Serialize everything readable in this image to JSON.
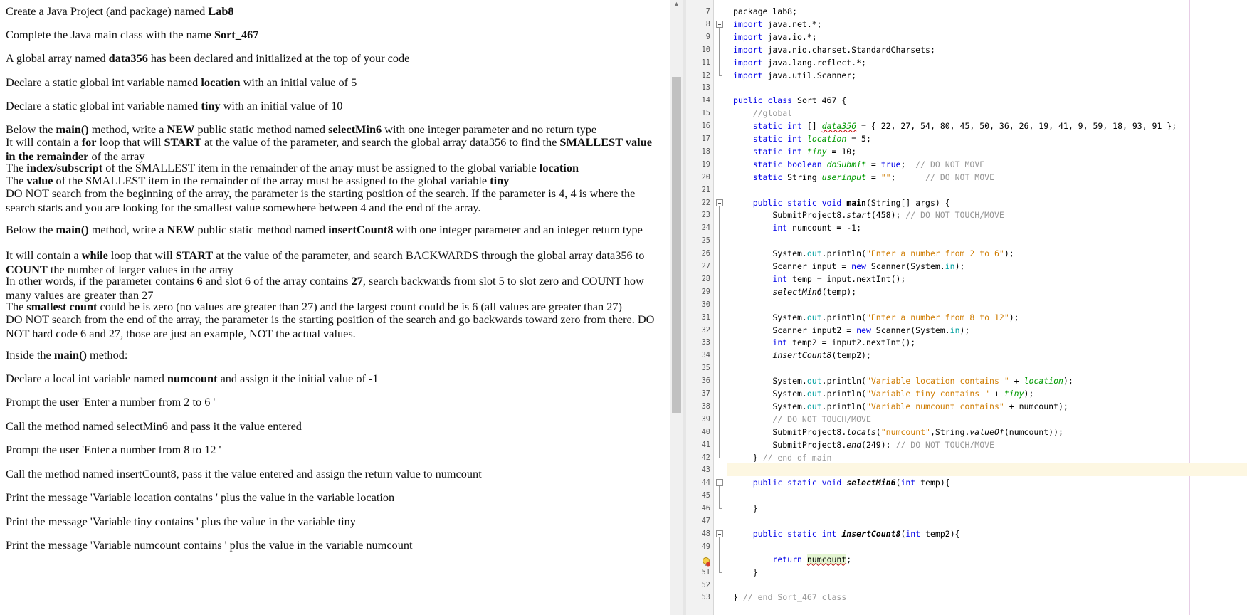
{
  "instructions": [
    [
      [
        "Create a Java Project (and package) named ",
        false
      ],
      [
        "Lab8",
        true
      ]
    ],
    [
      [
        "Complete the Java main class with the name ",
        false
      ],
      [
        "Sort_467",
        true
      ]
    ],
    [
      [
        "A global array named ",
        false
      ],
      [
        "data356",
        true
      ],
      [
        " has been declared and initialized at the top of your code",
        false
      ]
    ],
    [
      [
        "Declare a static global int variable named ",
        false
      ],
      [
        "location",
        true
      ],
      [
        " with an initial value of 5",
        false
      ]
    ],
    [
      [
        "Declare a static global int variable named ",
        false
      ],
      [
        "tiny",
        true
      ],
      [
        " with an initial value of 10",
        false
      ]
    ],
    [
      [
        "Below the ",
        false
      ],
      [
        "main()",
        true
      ],
      [
        " method, write a ",
        false
      ],
      [
        "NEW",
        true
      ],
      [
        " public static method named ",
        false
      ],
      [
        "selectMin6",
        true
      ],
      [
        " with one integer parameter and no return type",
        false
      ]
    ],
    [
      [
        "It will contain a ",
        false
      ],
      [
        "for",
        true
      ],
      [
        " loop that will ",
        false
      ],
      [
        "START",
        true
      ],
      [
        " at the value of the parameter, and search the global array data356 to find the ",
        false
      ],
      [
        "SMALLEST value in the remainder",
        true
      ],
      [
        " of the array",
        false
      ]
    ],
    [
      [
        "The ",
        false
      ],
      [
        "index/subscript",
        true
      ],
      [
        " of the SMALLEST item in the remainder of the array must be assigned to the global variable ",
        false
      ],
      [
        "location",
        true
      ]
    ],
    [
      [
        "The ",
        false
      ],
      [
        "value",
        true
      ],
      [
        " of the SMALLEST item in the remainder of the array must be assigned to the global variable ",
        false
      ],
      [
        "tiny",
        true
      ]
    ],
    [
      [
        "DO NOT search from the beginning of the array, the parameter is the starting position of the search. If the parameter is 4, 4 is where the search starts and you are looking for the smallest value somewhere between 4 and the end of the array.",
        false
      ]
    ],
    [
      [
        "Below the ",
        false
      ],
      [
        "main()",
        true
      ],
      [
        " method, write a ",
        false
      ],
      [
        "NEW",
        true
      ],
      [
        " public static method named ",
        false
      ],
      [
        "insertCount8",
        true
      ],
      [
        " with one integer parameter and an integer return type",
        false
      ]
    ],
    [
      [
        "It will contain a ",
        false
      ],
      [
        "while",
        true
      ],
      [
        " loop that will ",
        false
      ],
      [
        "START",
        true
      ],
      [
        " at the value of the parameter, and search BACKWARDS through the global array data356 to ",
        false
      ],
      [
        "COUNT",
        true
      ],
      [
        " the number of larger values in the array",
        false
      ]
    ],
    [
      [
        "In other words, if the parameter contains ",
        false
      ],
      [
        "6",
        true
      ],
      [
        " and slot 6 of the array contains ",
        false
      ],
      [
        "27",
        true
      ],
      [
        ", search backwards from slot 5 to slot zero and COUNT how many values are greater than 27",
        false
      ]
    ],
    [
      [
        "The ",
        false
      ],
      [
        "smallest count",
        true
      ],
      [
        " could be is zero (no values are greater than 27) and the largest count could be is 6 (all values are greater than 27)",
        false
      ]
    ],
    [
      [
        "DO NOT search from the end of the array, the parameter is the starting position of the search and go backwards toward zero from there. DO NOT hard code 6 and 27, those are just an example, NOT the actual values.",
        false
      ]
    ],
    [
      [
        "Inside the ",
        false
      ],
      [
        "main()",
        true
      ],
      [
        " method:",
        false
      ]
    ],
    [
      [
        "Declare a local int variable named ",
        false
      ],
      [
        "numcount",
        true
      ],
      [
        " and assign it the initial value of -1",
        false
      ]
    ],
    [
      [
        "Prompt the user 'Enter a number from 2 to 6 '",
        false
      ]
    ],
    [
      [
        "Call the method named selectMin6 and pass it the value entered",
        false
      ]
    ],
    [
      [
        "Prompt the user 'Enter a number from 8 to 12 '",
        false
      ]
    ],
    [
      [
        "Call the method named insertCount8, pass it the value entered and assign the return value to numcount",
        false
      ]
    ],
    [
      [
        "Print the message 'Variable location contains ' plus the value in the variable location",
        false
      ]
    ],
    [
      [
        "Print the message 'Variable tiny contains ' plus the value in the variable tiny",
        false
      ]
    ],
    [
      [
        "Print the message 'Variable numcount contains ' plus the value in the variable numcount",
        false
      ]
    ]
  ],
  "code_lines": [
    {
      "n": "7",
      "s": [
        [
          "package lab8;",
          ""
        ]
      ]
    },
    {
      "n": "8",
      "s": [
        [
          "import",
          "kw"
        ],
        [
          " java.net.*;",
          ""
        ]
      ]
    },
    {
      "n": "9",
      "s": [
        [
          "import",
          "kw"
        ],
        [
          " java.io.*;",
          ""
        ]
      ]
    },
    {
      "n": "10",
      "s": [
        [
          "import",
          "kw"
        ],
        [
          " java.nio.charset.StandardCharsets;",
          ""
        ]
      ]
    },
    {
      "n": "11",
      "s": [
        [
          "import",
          "kw"
        ],
        [
          " java.lang.reflect.*;",
          ""
        ]
      ]
    },
    {
      "n": "12",
      "s": [
        [
          "import",
          "kw"
        ],
        [
          " java.util.Scanner;",
          ""
        ]
      ]
    },
    {
      "n": "13",
      "s": []
    },
    {
      "n": "14",
      "s": [
        [
          "public class",
          "kw"
        ],
        [
          " Sort_467 {",
          ""
        ]
      ]
    },
    {
      "n": "15",
      "s": [
        [
          "    ",
          ""
        ],
        [
          "//global",
          "cm"
        ]
      ]
    },
    {
      "n": "16",
      "s": [
        [
          "    ",
          ""
        ],
        [
          "static int",
          "kw"
        ],
        [
          " [] ",
          ""
        ],
        [
          "data356",
          "fld sq"
        ],
        [
          " = { 22, 27, 54, 80, 45, 50, 36, 26, 19, 41, 9, 59, 18, 93, 91 };",
          ""
        ]
      ]
    },
    {
      "n": "17",
      "s": [
        [
          "    ",
          ""
        ],
        [
          "static int",
          "kw"
        ],
        [
          " ",
          ""
        ],
        [
          "location",
          "fld"
        ],
        [
          " = 5;",
          ""
        ]
      ]
    },
    {
      "n": "18",
      "s": [
        [
          "    ",
          ""
        ],
        [
          "static int",
          "kw"
        ],
        [
          " ",
          ""
        ],
        [
          "tiny",
          "fld"
        ],
        [
          " = 10;",
          ""
        ]
      ]
    },
    {
      "n": "19",
      "s": [
        [
          "    ",
          ""
        ],
        [
          "static boolean",
          "kw"
        ],
        [
          " ",
          ""
        ],
        [
          "doSubmit",
          "fld"
        ],
        [
          " = ",
          ""
        ],
        [
          "true",
          "kw"
        ],
        [
          ";  ",
          ""
        ],
        [
          "// DO NOT MOVE",
          "cm"
        ]
      ]
    },
    {
      "n": "20",
      "s": [
        [
          "    ",
          ""
        ],
        [
          "static",
          "kw"
        ],
        [
          " String ",
          ""
        ],
        [
          "userinput",
          "fld"
        ],
        [
          " = ",
          ""
        ],
        [
          "\"\"",
          "str"
        ],
        [
          ";      ",
          ""
        ],
        [
          "// DO NOT MOVE",
          "cm"
        ]
      ]
    },
    {
      "n": "21",
      "s": []
    },
    {
      "n": "22",
      "s": [
        [
          "    ",
          ""
        ],
        [
          "public static void",
          "kw"
        ],
        [
          " ",
          ""
        ],
        [
          "main",
          "bd"
        ],
        [
          "(String[] args) {",
          ""
        ]
      ]
    },
    {
      "n": "23",
      "s": [
        [
          "        SubmitProject8.",
          ""
        ],
        [
          "start",
          "it"
        ],
        [
          "(458); ",
          ""
        ],
        [
          "// DO NOT TOUCH/MOVE",
          "cm"
        ]
      ]
    },
    {
      "n": "24",
      "s": [
        [
          "        ",
          ""
        ],
        [
          "int",
          "kw"
        ],
        [
          " numcount = -1;",
          ""
        ]
      ]
    },
    {
      "n": "25",
      "s": []
    },
    {
      "n": "26",
      "s": [
        [
          "        System.",
          ""
        ],
        [
          "out",
          "st"
        ],
        [
          ".println(",
          ""
        ],
        [
          "\"Enter a number from 2 to 6\"",
          "str"
        ],
        [
          ");",
          ""
        ]
      ]
    },
    {
      "n": "27",
      "s": [
        [
          "        Scanner input = ",
          ""
        ],
        [
          "new",
          "kw"
        ],
        [
          " Scanner(System.",
          ""
        ],
        [
          "in",
          "st"
        ],
        [
          ");",
          ""
        ]
      ]
    },
    {
      "n": "28",
      "s": [
        [
          "        ",
          ""
        ],
        [
          "int",
          "kw"
        ],
        [
          " temp = input.nextInt();",
          ""
        ]
      ]
    },
    {
      "n": "29",
      "s": [
        [
          "        ",
          ""
        ],
        [
          "selectMin6",
          "it"
        ],
        [
          "(temp);",
          ""
        ]
      ]
    },
    {
      "n": "30",
      "s": []
    },
    {
      "n": "31",
      "s": [
        [
          "        System.",
          ""
        ],
        [
          "out",
          "st"
        ],
        [
          ".println(",
          ""
        ],
        [
          "\"Enter a number from 8 to 12\"",
          "str"
        ],
        [
          ");",
          ""
        ]
      ]
    },
    {
      "n": "32",
      "s": [
        [
          "        Scanner input2 = ",
          ""
        ],
        [
          "new",
          "kw"
        ],
        [
          " Scanner(System.",
          ""
        ],
        [
          "in",
          "st"
        ],
        [
          ");",
          ""
        ]
      ]
    },
    {
      "n": "33",
      "s": [
        [
          "        ",
          ""
        ],
        [
          "int",
          "kw"
        ],
        [
          " temp2 = input2.nextInt();",
          ""
        ]
      ]
    },
    {
      "n": "34",
      "s": [
        [
          "        ",
          ""
        ],
        [
          "insertCount8",
          "it"
        ],
        [
          "(temp2);",
          ""
        ]
      ]
    },
    {
      "n": "35",
      "s": []
    },
    {
      "n": "36",
      "s": [
        [
          "        System.",
          ""
        ],
        [
          "out",
          "st"
        ],
        [
          ".println(",
          ""
        ],
        [
          "\"Variable location contains \"",
          "str"
        ],
        [
          " + ",
          ""
        ],
        [
          "location",
          "fld"
        ],
        [
          ");",
          ""
        ]
      ]
    },
    {
      "n": "37",
      "s": [
        [
          "        System.",
          ""
        ],
        [
          "out",
          "st"
        ],
        [
          ".println(",
          ""
        ],
        [
          "\"Variable tiny contains \"",
          "str"
        ],
        [
          " + ",
          ""
        ],
        [
          "tiny",
          "fld"
        ],
        [
          ");",
          ""
        ]
      ]
    },
    {
      "n": "38",
      "s": [
        [
          "        System.",
          ""
        ],
        [
          "out",
          "st"
        ],
        [
          ".println(",
          ""
        ],
        [
          "\"Variable numcount contains\"",
          "str"
        ],
        [
          " + numcount);",
          ""
        ]
      ]
    },
    {
      "n": "39",
      "s": [
        [
          "        ",
          ""
        ],
        [
          "// DO NOT TOUCH/MOVE",
          "cm"
        ]
      ]
    },
    {
      "n": "40",
      "s": [
        [
          "        SubmitProject8.",
          ""
        ],
        [
          "locals",
          "it"
        ],
        [
          "(",
          ""
        ],
        [
          "\"numcount\"",
          "str"
        ],
        [
          ",String.",
          ""
        ],
        [
          "valueOf",
          "it"
        ],
        [
          "(numcount));",
          ""
        ]
      ]
    },
    {
      "n": "41",
      "s": [
        [
          "        SubmitProject8.",
          ""
        ],
        [
          "end",
          "it"
        ],
        [
          "(249); ",
          ""
        ],
        [
          "// DO NOT TOUCH/MOVE",
          "cm"
        ]
      ]
    },
    {
      "n": "42",
      "s": [
        [
          "    } ",
          ""
        ],
        [
          "// end of main",
          "cm"
        ]
      ]
    },
    {
      "n": "43",
      "s": []
    },
    {
      "n": "44",
      "s": [
        [
          "    ",
          ""
        ],
        [
          "public static void",
          "kw"
        ],
        [
          " ",
          ""
        ],
        [
          "selectMin6",
          "it bd"
        ],
        [
          "(",
          ""
        ],
        [
          "int",
          "kw"
        ],
        [
          " temp){",
          ""
        ]
      ]
    },
    {
      "n": "45",
      "s": []
    },
    {
      "n": "46",
      "s": [
        [
          "    }",
          ""
        ]
      ]
    },
    {
      "n": "47",
      "s": []
    },
    {
      "n": "48",
      "s": [
        [
          "    ",
          ""
        ],
        [
          "public static int",
          "kw"
        ],
        [
          " ",
          ""
        ],
        [
          "insertCount8",
          "it bd"
        ],
        [
          "(",
          ""
        ],
        [
          "int",
          "kw"
        ],
        [
          " temp2){",
          ""
        ]
      ]
    },
    {
      "n": "49",
      "s": []
    },
    {
      "n": "",
      "s": [
        [
          "        ",
          ""
        ],
        [
          "return",
          "kw"
        ],
        [
          " ",
          ""
        ],
        [
          "numcount",
          "warn sq"
        ],
        [
          ";",
          ""
        ]
      ]
    },
    {
      "n": "51",
      "s": [
        [
          "    }",
          ""
        ]
      ]
    },
    {
      "n": "52",
      "s": []
    },
    {
      "n": "53",
      "s": [
        [
          "} ",
          ""
        ],
        [
          "// end Sort_467 class",
          "cm"
        ]
      ]
    }
  ],
  "scrollbar": {
    "up_arrow": "▲"
  }
}
